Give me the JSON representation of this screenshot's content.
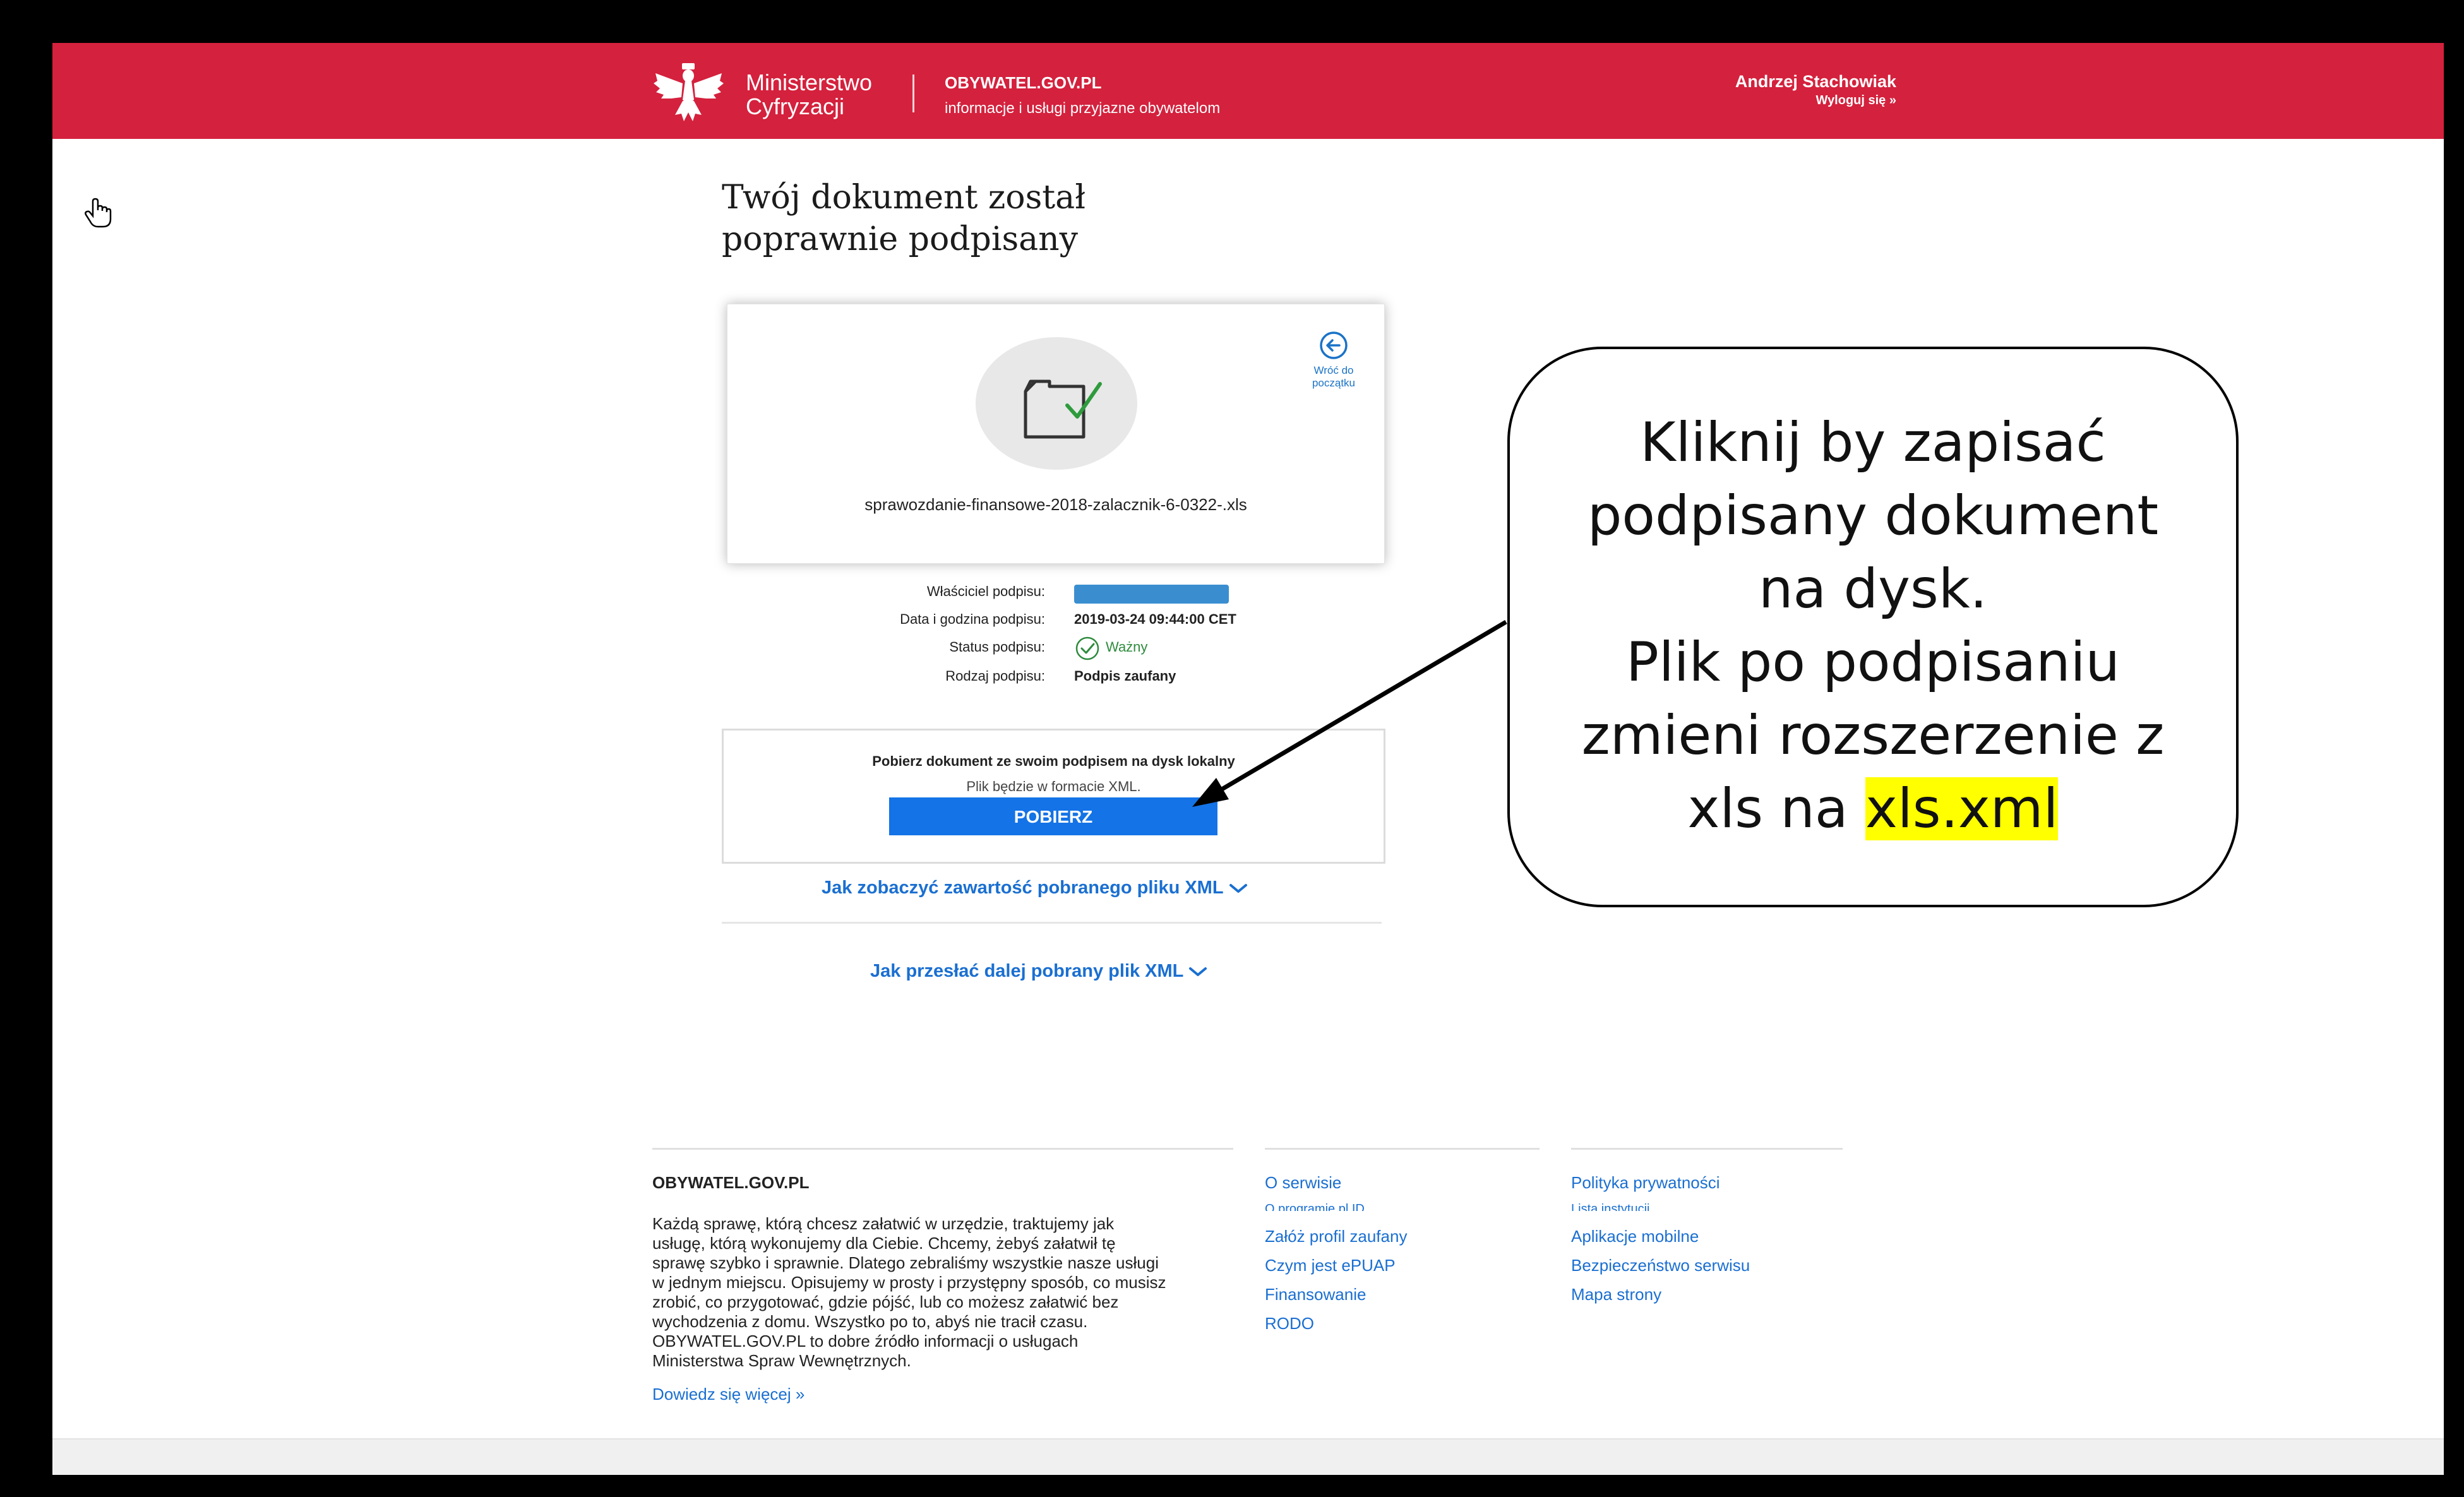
{
  "header": {
    "ministry_line1": "Ministerstwo",
    "ministry_line2": "Cyfryzacji",
    "portal_name": "OBYWATEL.GOV.PL",
    "portal_tagline": "informacje i usługi przyjazne obywatelom",
    "user_name": "Andrzej Stachowiak",
    "logout": "Wyloguj się »"
  },
  "main": {
    "title_line1": "Twój dokument został",
    "title_line2": "poprawnie podpisany",
    "back_label_line1": "Wróć do",
    "back_label_line2": "początku",
    "filename": "sprawozdanie-finansowe-2018-zalacznik-6-0322-.xls"
  },
  "signature": {
    "owner_label": "Właściciel podpisu:",
    "date_label": "Data i godzina podpisu:",
    "date_value": "2019-03-24 09:44:00 CET",
    "status_label": "Status podpisu:",
    "status_value": "Ważny",
    "type_label": "Rodzaj podpisu:",
    "type_value": "Podpis zaufany"
  },
  "download": {
    "title": "Pobierz dokument ze swoim podpisem na dysk lokalny",
    "note": "Plik będzie w formacie XML.",
    "button": "POBIERZ"
  },
  "accordions": [
    "Jak zobaczyć zawartość pobranego pliku XML",
    "Jak przesłać dalej pobrany plik XML"
  ],
  "footer": {
    "title": "OBYWATEL.GOV.PL",
    "description": "Każdą sprawę, którą chcesz załatwić w urzędzie, traktujemy jak\nusługę, którą wykonujemy dla Ciebie. Chcemy, żebyś załatwił tę\nsprawę szybko i sprawnie. Dlatego zebraliśmy wszystkie nasze usługi\nw jednym miejscu. Opisujemy w prosty i przystępny sposób, co musisz\nzrobić, co przygotować, gdzie pójść, lub co możesz załatwić bez\nwychodzenia z domu. Wszystko po to, abyś nie tracił czasu.\nOBYWATEL.GOV.PL to dobre źródło informacji o usługach\nMinisterstwa Spraw Wewnętrznych.",
    "more_link": "Dowiedz się więcej »",
    "col2": [
      "O serwisie",
      "O programie pl.ID",
      "Załóż profil zaufany",
      "Czym jest ePUAP",
      "Finansowanie",
      "RODO"
    ],
    "col3": [
      "Polityka prywatności",
      "Lista instytucji",
      "Aplikacje mobilne",
      "Bezpieczeństwo serwisu",
      "Mapa strony"
    ]
  },
  "callout": {
    "line1": "Kliknij by zapisać",
    "line2": "podpisany dokument",
    "line3": "na dysk.",
    "line4": "Plik po podpisaniu",
    "line5": "zmieni rozszerzenie z",
    "line6_prefix": "xls na ",
    "line6_highlight": "xls.xml"
  },
  "colors": {
    "header_red": "#d4213d",
    "link_blue": "#1a6fd1",
    "button_blue": "#1473e6",
    "valid_green": "#2e8b3d",
    "highlight_yellow": "#ffff00"
  },
  "icons": [
    "white-eagle-emblem-icon",
    "document-check-icon",
    "back-arrow-icon",
    "check-circle-icon",
    "chevron-down-icon",
    "hand-cursor-icon"
  ]
}
